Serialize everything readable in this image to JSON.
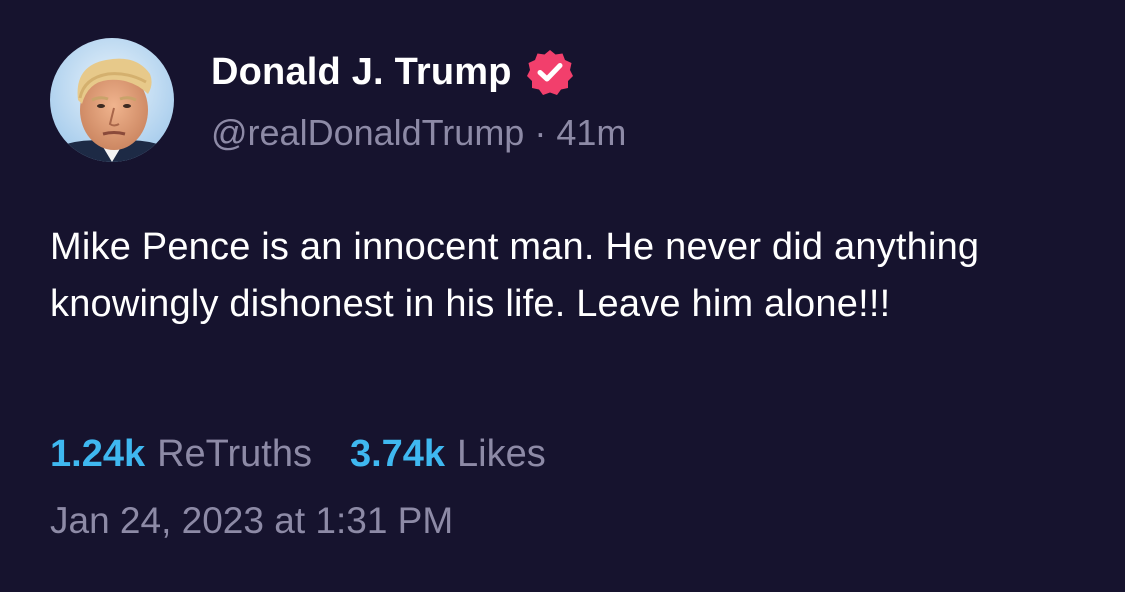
{
  "post": {
    "author": {
      "display_name": "Donald J. Trump",
      "handle": "@realDonaldTrump",
      "verified": true,
      "verified_badge_color": "#f23f6c",
      "avatar_icon": "user-avatar"
    },
    "relative_time": "41m",
    "separator": "·",
    "text": "Mike Pence is an innocent man. He never did anything knowingly dishonest in his life. Leave him alone!!!",
    "stats": {
      "retruths_count": "1.24k",
      "retruths_label": "ReTruths",
      "likes_count": "3.74k",
      "likes_label": "Likes"
    },
    "timestamp": "Jan 24, 2023 at 1:31 PM"
  },
  "colors": {
    "background": "#16132e",
    "text_primary": "#ffffff",
    "text_secondary": "#8d8aa6",
    "stat_accent": "#3fb8f0"
  }
}
